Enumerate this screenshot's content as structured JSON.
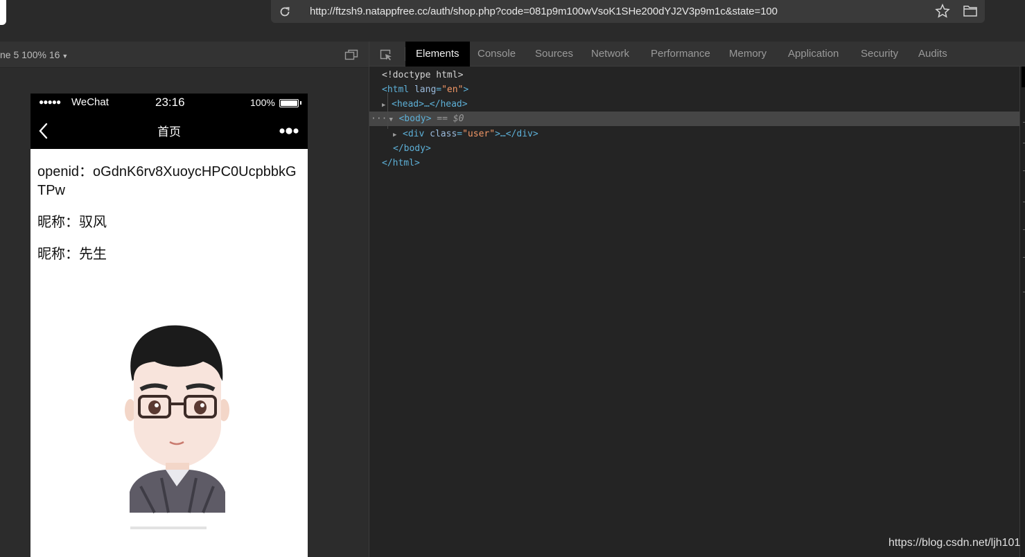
{
  "browser": {
    "url": "http://ftzsh9.natappfree.cc/auth/shop.php?code=081p9m100wVsoK1SHe200dYJ2V3p9m1c&state=100"
  },
  "device_toolbar": {
    "device_label": "ne 5  100%  16"
  },
  "phone": {
    "status": {
      "signal": "●●●●●",
      "carrier": "WeChat",
      "time": "23:16",
      "battery": "100%"
    },
    "nav_title": "首页",
    "lines": [
      "openid：oGdnK6rv8XuoycHPC0UcpbbkGTPw",
      "昵称：驭风",
      "昵称：先生"
    ]
  },
  "devtools": {
    "tabs": [
      "Elements",
      "Console",
      "Sources",
      "Network",
      "Performance",
      "Memory",
      "Application",
      "Security",
      "Audits"
    ],
    "active_tab": "Elements",
    "dom": {
      "doctype": "<!doctype html>",
      "html_open": "<html",
      "lang_attr": "lang",
      "lang_val": "\"en\"",
      "html_close_bracket": ">",
      "head": "<head>…</head>",
      "body_open": "<body>",
      "body_eq": "== $0",
      "div_open": "<div",
      "class_attr": "class",
      "class_val": "\"user\"",
      "div_rest": ">…</div>",
      "body_close": "</body>",
      "html_close": "</html>"
    }
  },
  "watermark": "https://blog.csdn.net/ljh101",
  "colors": {
    "accent_tag": "#5db0d7",
    "attr_value": "#f29766",
    "panel_bg": "#242424"
  }
}
